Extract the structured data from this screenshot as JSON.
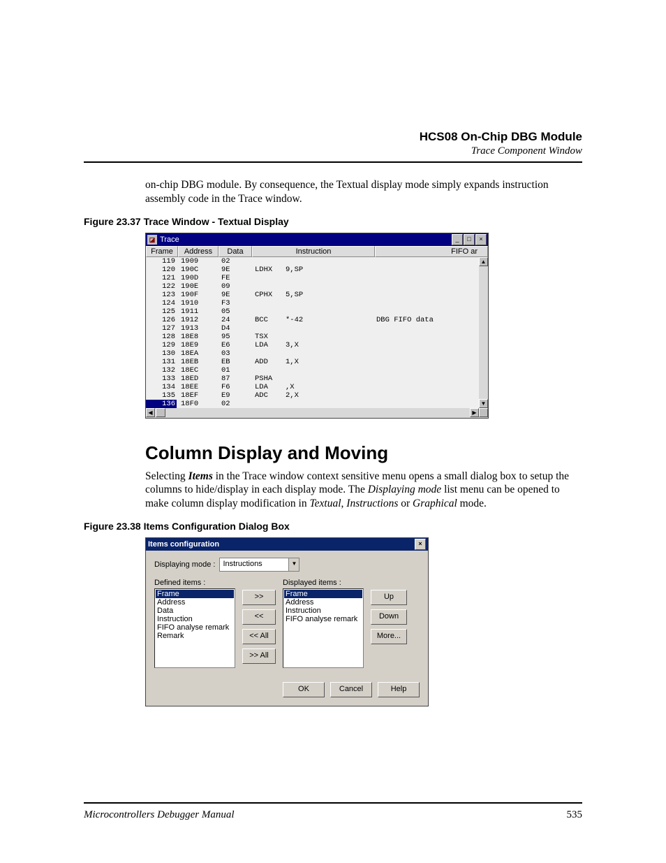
{
  "header": {
    "title": "HCS08 On-Chip DBG Module",
    "subtitle": "Trace Component Window"
  },
  "intro_text": "on-chip DBG module. By consequence, the Textual display mode simply expands instruction assembly code in the Trace window.",
  "fig1_caption": "Figure 23.37  Trace Window - Textual Display",
  "trace_window": {
    "title": "Trace",
    "headers": {
      "frame": "Frame",
      "address": "Address",
      "data": "Data",
      "instruction": "Instruction",
      "fifo": "FIFO ar"
    },
    "rows": [
      {
        "frame": "119",
        "addr": "1909",
        "data": "02",
        "mn": "",
        "op": "",
        "fifo": ""
      },
      {
        "frame": "120",
        "addr": "190C",
        "data": "9E",
        "mn": "LDHX",
        "op": "9,SP",
        "fifo": ""
      },
      {
        "frame": "121",
        "addr": "190D",
        "data": "FE",
        "mn": "",
        "op": "",
        "fifo": ""
      },
      {
        "frame": "122",
        "addr": "190E",
        "data": "09",
        "mn": "",
        "op": "",
        "fifo": ""
      },
      {
        "frame": "123",
        "addr": "190F",
        "data": "9E",
        "mn": "CPHX",
        "op": "5,SP",
        "fifo": ""
      },
      {
        "frame": "124",
        "addr": "1910",
        "data": "F3",
        "mn": "",
        "op": "",
        "fifo": ""
      },
      {
        "frame": "125",
        "addr": "1911",
        "data": "05",
        "mn": "",
        "op": "",
        "fifo": ""
      },
      {
        "frame": "126",
        "addr": "1912",
        "data": "24",
        "mn": "BCC",
        "op": "*-42",
        "fifo": "DBG FIFO data"
      },
      {
        "frame": "127",
        "addr": "1913",
        "data": "D4",
        "mn": "",
        "op": "",
        "fifo": ""
      },
      {
        "frame": "128",
        "addr": "18E8",
        "data": "95",
        "mn": "TSX",
        "op": "",
        "fifo": ""
      },
      {
        "frame": "129",
        "addr": "18E9",
        "data": "E6",
        "mn": "LDA",
        "op": "3,X",
        "fifo": ""
      },
      {
        "frame": "130",
        "addr": "18EA",
        "data": "03",
        "mn": "",
        "op": "",
        "fifo": ""
      },
      {
        "frame": "131",
        "addr": "18EB",
        "data": "EB",
        "mn": "ADD",
        "op": "1,X",
        "fifo": ""
      },
      {
        "frame": "132",
        "addr": "18EC",
        "data": "01",
        "mn": "",
        "op": "",
        "fifo": ""
      },
      {
        "frame": "133",
        "addr": "18ED",
        "data": "87",
        "mn": "PSHA",
        "op": "",
        "fifo": ""
      },
      {
        "frame": "134",
        "addr": "18EE",
        "data": "F6",
        "mn": "LDA",
        "op": ",X",
        "fifo": ""
      },
      {
        "frame": "135",
        "addr": "18EF",
        "data": "E9",
        "mn": "ADC",
        "op": "2,X",
        "fifo": ""
      },
      {
        "frame": "136",
        "addr": "18F0",
        "data": "02",
        "mn": "",
        "op": "",
        "fifo": "",
        "sel": true
      }
    ]
  },
  "section_heading": "Column Display and Moving",
  "section_para_parts": {
    "a": "Selecting ",
    "b": "Items",
    "c": " in the Trace window context sensitive menu opens a small dialog box to setup the columns to hide/display in each display mode. The ",
    "d": "Displaying mode",
    "e": " list menu can be opened to make column display modification in ",
    "f": "Textual",
    "g": ", ",
    "h": "Instructions",
    "i": " or ",
    "j": "Graphical",
    "k": " mode."
  },
  "fig2_caption": "Figure 23.38  Items Configuration Dialog Box",
  "items_dialog": {
    "title": "Items configuration",
    "mode_label": "Displaying mode :",
    "mode_value": "Instructions",
    "defined_label": "Defined items :",
    "displayed_label": "Displayed items :",
    "defined_items": [
      {
        "label": "Frame",
        "sel": true
      },
      {
        "label": "Address"
      },
      {
        "label": "Data"
      },
      {
        "label": "Instruction"
      },
      {
        "label": "FIFO analyse remark"
      },
      {
        "label": "Remark"
      }
    ],
    "displayed_items": [
      {
        "label": "Frame",
        "sel": true
      },
      {
        "label": "Address"
      },
      {
        "label": "Instruction"
      },
      {
        "label": "FIFO analyse remark"
      }
    ],
    "mid_buttons": {
      "right": ">>",
      "left": "<<",
      "left_all": "<< All",
      "right_all": ">> All"
    },
    "right_buttons": {
      "up": "Up",
      "down": "Down",
      "more": "More..."
    },
    "bottom_buttons": {
      "ok": "OK",
      "cancel": "Cancel",
      "help": "Help"
    }
  },
  "footer": {
    "manual": "Microcontrollers Debugger Manual",
    "page": "535"
  }
}
